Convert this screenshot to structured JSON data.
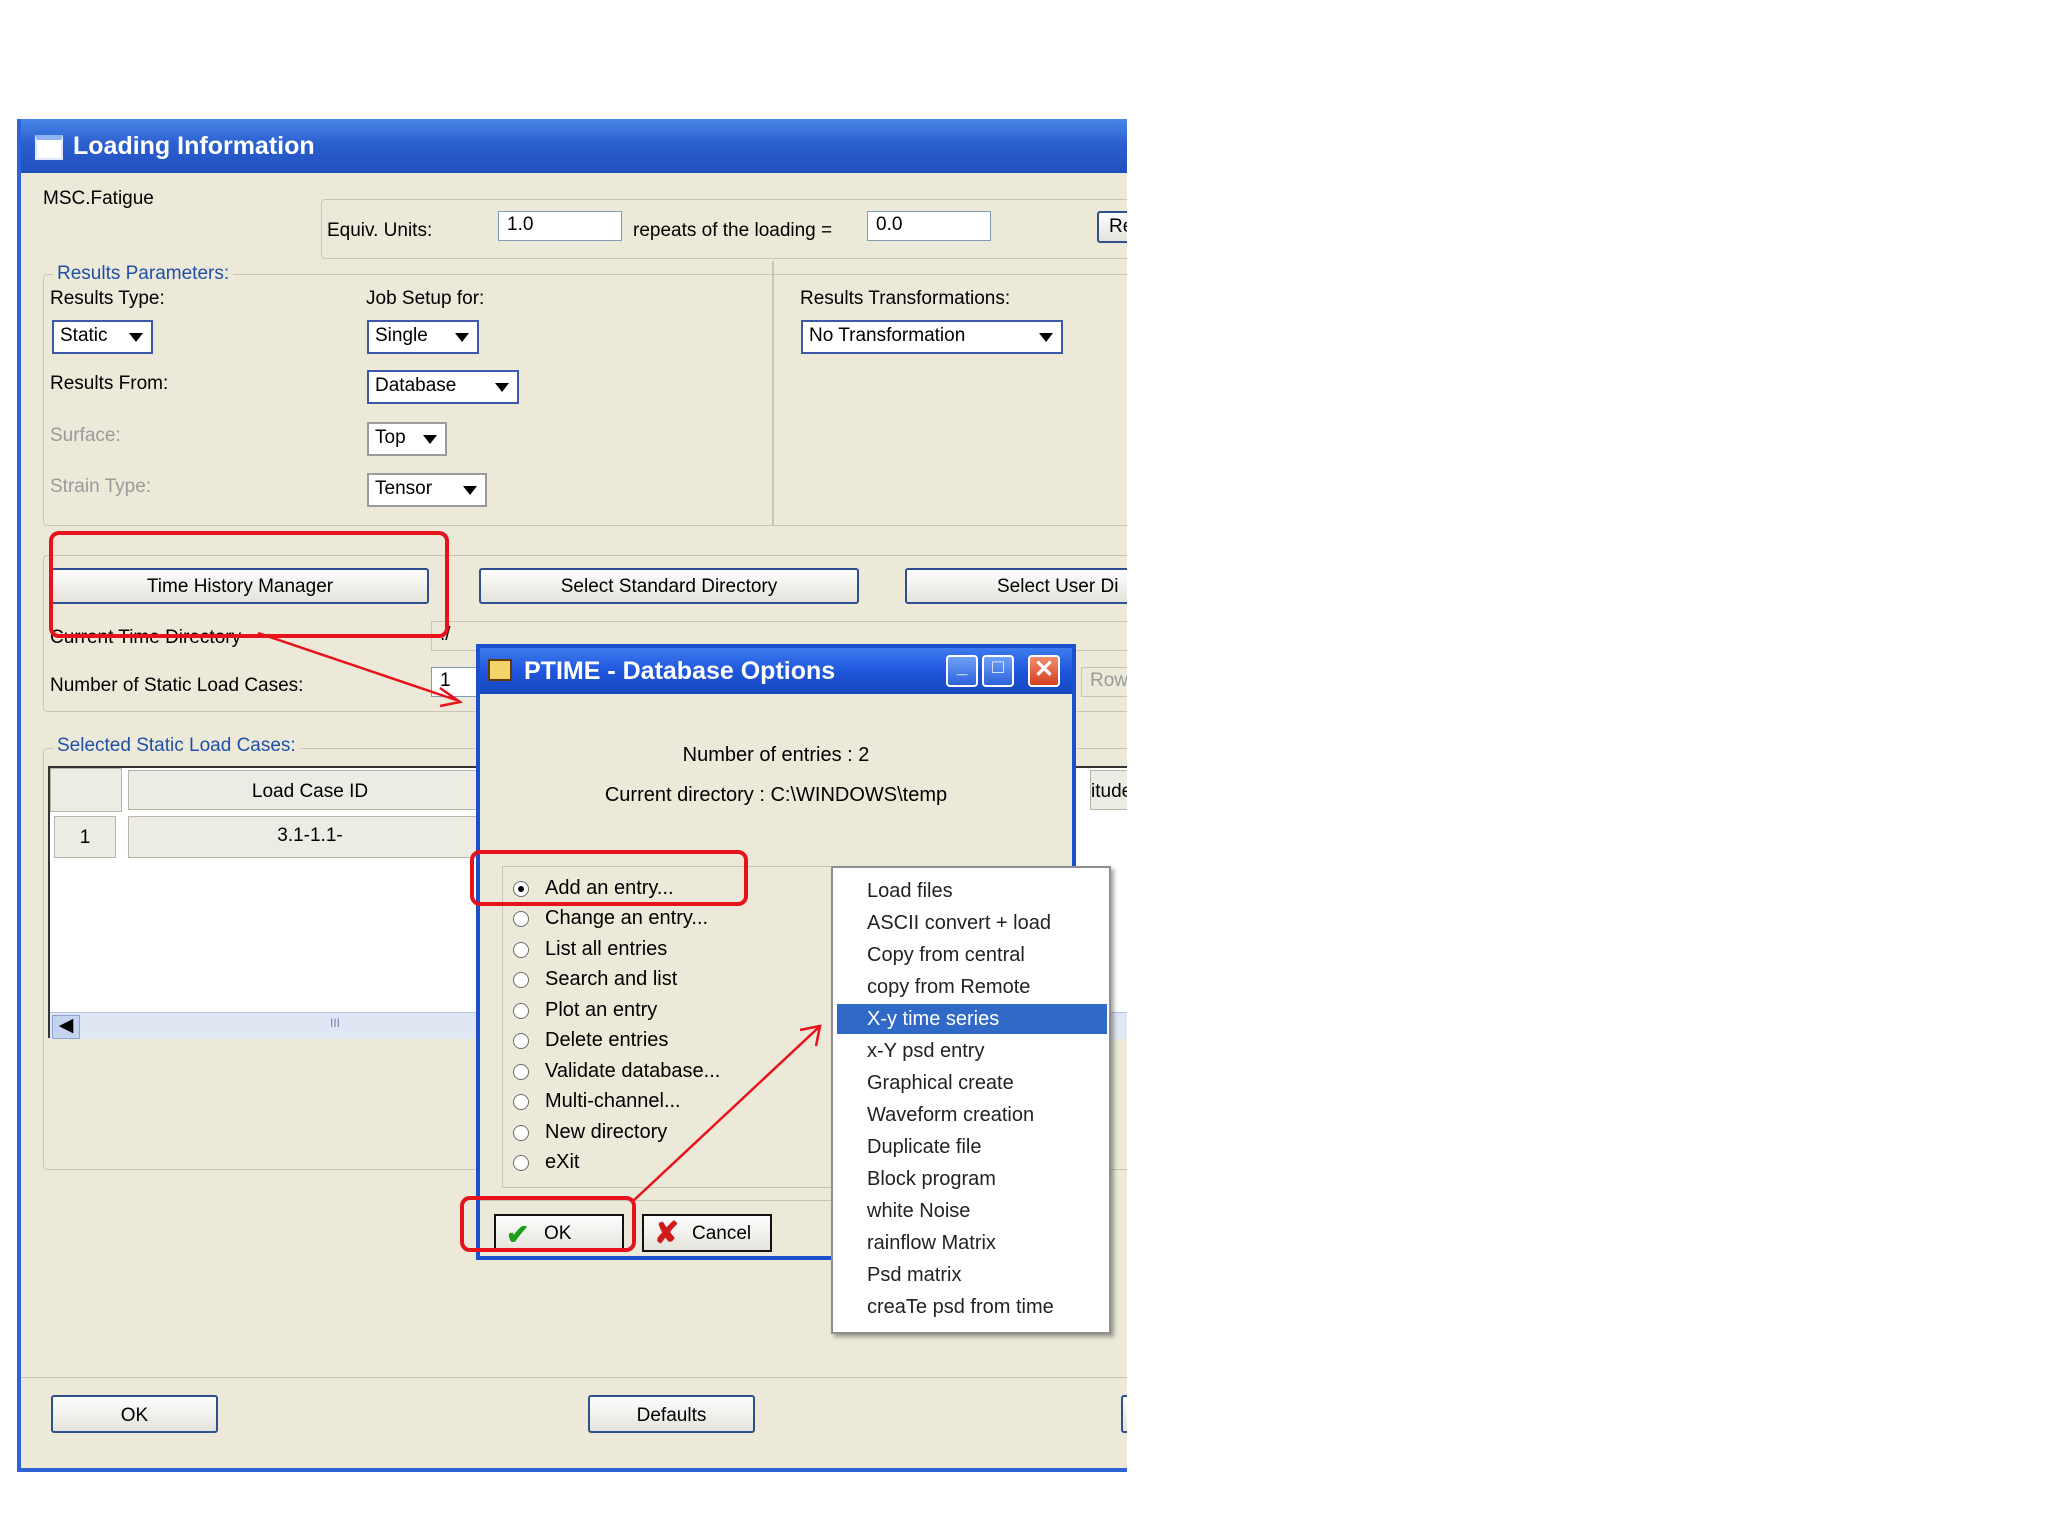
{
  "window": {
    "title": "Loading Information",
    "app_label": "MSC.Fatigue",
    "equiv_units_label": "Equiv. Units:",
    "equiv_units_value": "1.0",
    "repeats_label": "repeats of the loading =",
    "repeats_value": "0.0",
    "partial_button": "Re"
  },
  "results_parameters": {
    "group_label": "Results Parameters:",
    "results_type_label": "Results Type:",
    "results_type_value": "Static",
    "job_setup_label": "Job Setup for:",
    "job_setup_value": "Single",
    "results_from_label": "Results From:",
    "results_from_value": "Database",
    "surface_label": "Surface:",
    "surface_value": "Top",
    "strain_type_label": "Strain Type:",
    "strain_type_value": "Tensor",
    "transformations_label": "Results Transformations:",
    "transformations_value": "No Transformation"
  },
  "buttons": {
    "time_history_manager": "Time History Manager",
    "select_standard_directory": "Select Standard Directory",
    "select_user_directory": "Select User Di"
  },
  "time_dir": {
    "current_label": "Current Time Directory",
    "current_value": "./",
    "num_cases_label": "Number of Static Load Cases:",
    "num_cases_value": "1",
    "row_label": "Row"
  },
  "selected_cases": {
    "group_label": "Selected Static Load Cases:",
    "col_load_case": "Load Case ID",
    "col_partial": "itude",
    "rows": [
      {
        "num": "1",
        "load_case": "3.1-1.1-"
      }
    ],
    "scroll_grip": "III"
  },
  "footer": {
    "ok": "OK",
    "defaults": "Defaults"
  },
  "dialog": {
    "title": "PTIME -  Database Options",
    "entries_text": "Number of entries : 2",
    "directory_text": "Current directory : C:\\WINDOWS\\temp",
    "options": [
      {
        "label": "Add an entry...",
        "selected": true
      },
      {
        "label": "Change an entry...",
        "selected": false
      },
      {
        "label": "List all entries",
        "selected": false
      },
      {
        "label": "Search and list",
        "selected": false
      },
      {
        "label": "Plot an entry",
        "selected": false
      },
      {
        "label": "Delete entries",
        "selected": false
      },
      {
        "label": "Validate database...",
        "selected": false
      },
      {
        "label": "Multi-channel...",
        "selected": false
      },
      {
        "label": "New directory",
        "selected": false
      },
      {
        "label": "eXit",
        "selected": false
      }
    ],
    "ok": "OK",
    "cancel": "Cancel"
  },
  "submenu": {
    "items": [
      "Load files",
      "ASCII convert + load",
      "Copy from central",
      "copy from Remote",
      "X-y time series",
      "x-Y psd entry",
      "Graphical create",
      "Waveform creation",
      "Duplicate file",
      "Block program",
      "white Noise",
      "rainflow Matrix",
      "Psd matrix",
      "creaTe psd from time"
    ],
    "selected_index": 4
  },
  "colors": {
    "title_blue": "#2c60cf",
    "highlight_red": "#e8121c",
    "menu_selection": "#3169c6",
    "window_background": "#ece9d8"
  }
}
